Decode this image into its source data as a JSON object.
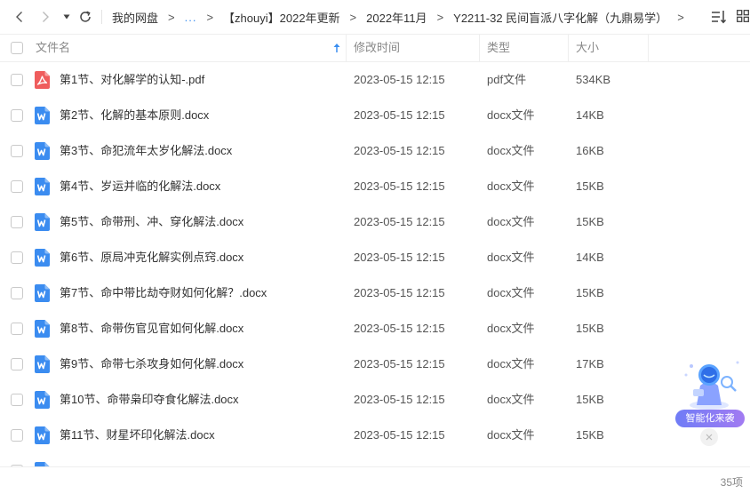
{
  "nav": {
    "back_icon": "chevron-left-icon",
    "forward_icon": "chevron-right-icon",
    "history_icon": "caret-down-icon",
    "refresh_icon": "refresh-icon"
  },
  "breadcrumb": {
    "root": "我的网盘",
    "ellipsis": "...",
    "items": [
      "【zhouyi】2022年更新",
      "2022年11月",
      "Y2211-32 民间盲派八字化解（九鼎易学）"
    ]
  },
  "header": {
    "name": "文件名",
    "modified": "修改时间",
    "type": "类型",
    "size": "大小",
    "sort_icon": "sort-ascending-arrow-icon"
  },
  "files": [
    {
      "name": "第1节、对化解学的认知-.pdf",
      "time": "2023-05-15 12:15",
      "type": "pdf文件",
      "size": "534KB",
      "icon": "pdf-file-icon"
    },
    {
      "name": "第2节、化解的基本原则.docx",
      "time": "2023-05-15 12:15",
      "type": "docx文件",
      "size": "14KB",
      "icon": "word-file-icon"
    },
    {
      "name": "第3节、命犯流年太岁化解法.docx",
      "time": "2023-05-15 12:15",
      "type": "docx文件",
      "size": "16KB",
      "icon": "word-file-icon"
    },
    {
      "name": "第4节、岁运并临的化解法.docx",
      "time": "2023-05-15 12:15",
      "type": "docx文件",
      "size": "15KB",
      "icon": "word-file-icon"
    },
    {
      "name": "第5节、命带刑、冲、穿化解法.docx",
      "time": "2023-05-15 12:15",
      "type": "docx文件",
      "size": "15KB",
      "icon": "word-file-icon"
    },
    {
      "name": "第6节、原局冲克化解实例点窍.docx",
      "time": "2023-05-15 12:15",
      "type": "docx文件",
      "size": "14KB",
      "icon": "word-file-icon"
    },
    {
      "name": "第7节、命中带比劫夺财如何化解？.docx",
      "time": "2023-05-15 12:15",
      "type": "docx文件",
      "size": "15KB",
      "icon": "word-file-icon"
    },
    {
      "name": "第8节、命带伤官见官如何化解.docx",
      "time": "2023-05-15 12:15",
      "type": "docx文件",
      "size": "15KB",
      "icon": "word-file-icon"
    },
    {
      "name": "第9节、命带七杀攻身如何化解.docx",
      "time": "2023-05-15 12:15",
      "type": "docx文件",
      "size": "17KB",
      "icon": "word-file-icon"
    },
    {
      "name": "第10节、命带枭印夺食化解法.docx",
      "time": "2023-05-15 12:15",
      "type": "docx文件",
      "size": "15KB",
      "icon": "word-file-icon"
    },
    {
      "name": "第11节、财星坏印化解法.docx",
      "time": "2023-05-15 12:15",
      "type": "docx文件",
      "size": "15KB",
      "icon": "word-file-icon"
    },
    {
      "name": "",
      "time": "",
      "type": "",
      "size": "",
      "icon": "word-file-icon"
    }
  ],
  "footer": {
    "count": "35项"
  },
  "promo": {
    "label": "智能化来袭",
    "icon": "ai-robot-icon",
    "close_icon": "close-icon"
  },
  "colors": {
    "accent": "#3a8ef0",
    "word_icon": "#3b8cf0",
    "pdf_icon": "#ef5d5d",
    "text": "#333333",
    "muted": "#888888"
  }
}
